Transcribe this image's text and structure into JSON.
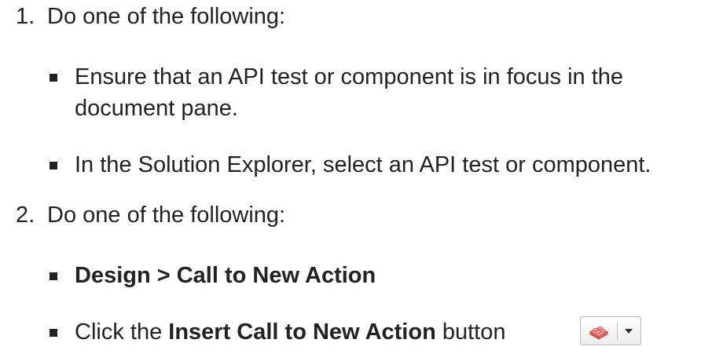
{
  "steps": [
    {
      "number": "1.",
      "text": "Do one of the following:",
      "bullets": [
        {
          "line1": "Ensure that an API test or component is in focus in the",
          "line2": "document pane."
        },
        {
          "line1": "In the Solution Explorer, select an API test or component."
        }
      ]
    },
    {
      "number": "2.",
      "text": "Do one of the following:",
      "bullets": [
        {
          "bold": "Design > Call to New Action"
        },
        {
          "pre": "Click the ",
          "bold": "Insert Call to New Action",
          "post": " button"
        }
      ]
    }
  ],
  "toolbar_button": {
    "icon": "lego-brick-icon",
    "dropdown_icon": "dropdown-arrow-icon"
  }
}
